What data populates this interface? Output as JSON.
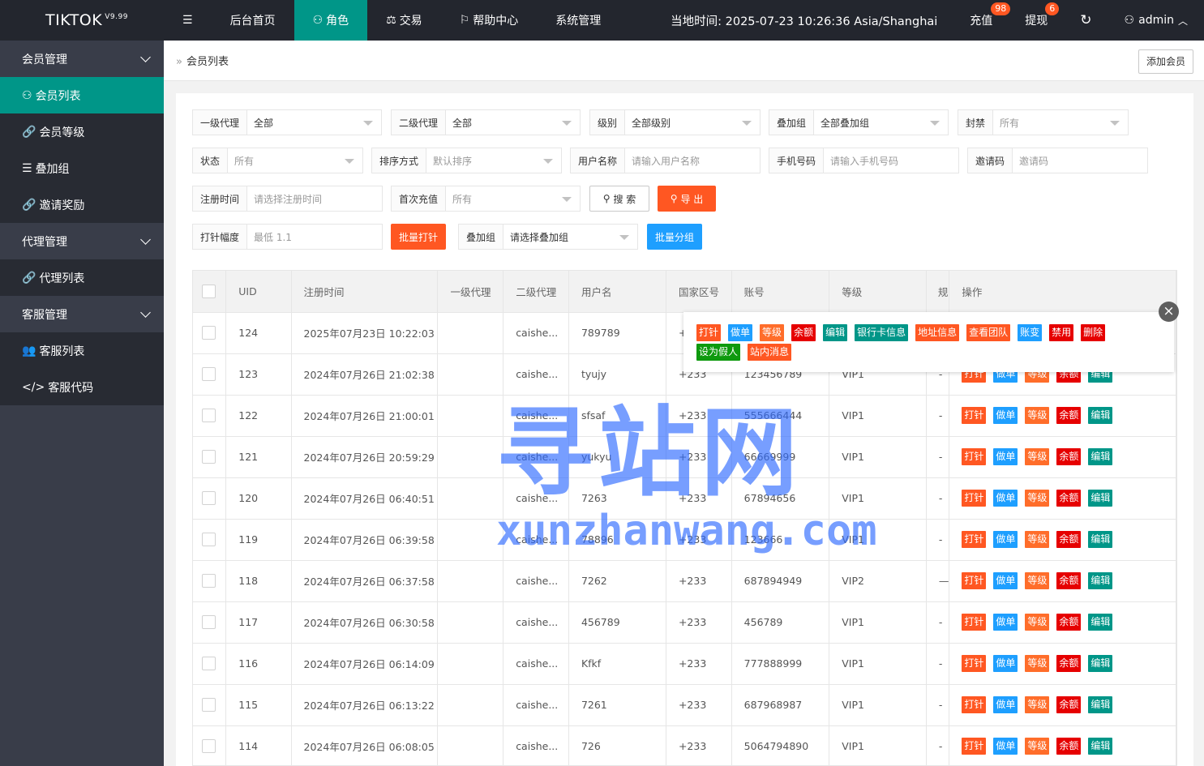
{
  "app": {
    "logo": "TIKTOK",
    "version": "V9.99"
  },
  "topnav": [
    {
      "label": "后台首页",
      "icon": ""
    },
    {
      "label": "角色",
      "icon": "user-icon"
    },
    {
      "label": "交易",
      "icon": "scale-icon"
    },
    {
      "label": "帮助中心",
      "icon": "flag-icon"
    },
    {
      "label": "系统管理",
      "icon": ""
    }
  ],
  "topright": {
    "time": "当地时间: 2025-07-23 10:26:36  Asia/Shanghai",
    "recharge": "充值",
    "recharge_badge": "98",
    "withdraw": "提现",
    "withdraw_badge": "6",
    "user": "admin"
  },
  "sidebar": {
    "g1": "会员管理",
    "i1": "会员列表",
    "i2": "会员等级",
    "i3": "叠加组",
    "i4": "邀请奖励",
    "g2": "代理管理",
    "i5": "代理列表",
    "g3": "客服管理",
    "i6": "客服列表",
    "i7": "客服代码"
  },
  "crumb": "会员列表",
  "add_member": "添加会员",
  "filters": {
    "agent1": {
      "label": "一级代理",
      "value": "全部"
    },
    "agent2": {
      "label": "二级代理",
      "value": "全部"
    },
    "level": {
      "label": "级别",
      "value": "全部级别"
    },
    "group": {
      "label": "叠加组",
      "value": "全部叠加组"
    },
    "ban": {
      "label": "封禁",
      "value": "所有"
    },
    "status": {
      "label": "状态",
      "value": "所有"
    },
    "sort": {
      "label": "排序方式",
      "value": "默认排序"
    },
    "username": {
      "label": "用户名称",
      "placeholder": "请输入用户名称"
    },
    "phone": {
      "label": "手机号码",
      "placeholder": "请输入手机号码"
    },
    "invite": {
      "label": "邀请码",
      "placeholder": "邀请码"
    },
    "regtime": {
      "label": "注册时间",
      "placeholder": "请选择注册时间"
    },
    "firstcharge": {
      "label": "首次充值",
      "value": "所有"
    },
    "search": "搜 索",
    "export": "导 出",
    "range": {
      "label": "打针幅度",
      "placeholder": "最低 1.1"
    },
    "batch_inject": "批量打针",
    "group2": {
      "label": "叠加组",
      "value": "请选择叠加组"
    },
    "batch_group": "批量分组"
  },
  "table": {
    "headers": [
      "UID",
      "注册时间",
      "一级代理",
      "二级代理",
      "用户名",
      "国家区号",
      "账号",
      "等级",
      "规",
      "操作"
    ],
    "rows": [
      {
        "uid": "124",
        "time": "2025年07月23日 10:22:03",
        "a1": "",
        "a2": "caishe...",
        "user": "789789",
        "cc": "+",
        "acc": "",
        "lvl": "",
        "x": ""
      },
      {
        "uid": "123",
        "time": "2024年07月26日 21:02:38",
        "a1": "",
        "a2": "caishe...",
        "user": "tyujy",
        "cc": "+233",
        "acc": "123456789",
        "lvl": "VIP1",
        "x": "-"
      },
      {
        "uid": "122",
        "time": "2024年07月26日 21:00:01",
        "a1": "",
        "a2": "caishe...",
        "user": "sfsaf",
        "cc": "+233",
        "acc": "555666444",
        "lvl": "VIP1",
        "x": "-"
      },
      {
        "uid": "121",
        "time": "2024年07月26日 20:59:29",
        "a1": "",
        "a2": "caishe...",
        "user": "yukyu",
        "cc": "+233",
        "acc": "66669999",
        "lvl": "VIP1",
        "x": "-"
      },
      {
        "uid": "120",
        "time": "2024年07月26日 06:40:51",
        "a1": "",
        "a2": "caishe...",
        "user": "7263",
        "cc": "+233",
        "acc": "67894656",
        "lvl": "VIP1",
        "x": "-"
      },
      {
        "uid": "119",
        "time": "2024年07月26日 06:39:58",
        "a1": "",
        "a2": "caishe...",
        "user": "78896",
        "cc": "+233",
        "acc": "123666",
        "lvl": "VIP1",
        "x": "-"
      },
      {
        "uid": "118",
        "time": "2024年07月26日 06:37:58",
        "a1": "",
        "a2": "caishe...",
        "user": "7262",
        "cc": "+233",
        "acc": "687894949",
        "lvl": "VIP2",
        "x": "—"
      },
      {
        "uid": "117",
        "time": "2024年07月26日 06:30:58",
        "a1": "",
        "a2": "caishe...",
        "user": "456789",
        "cc": "+233",
        "acc": "456789",
        "lvl": "VIP1",
        "x": "-"
      },
      {
        "uid": "116",
        "time": "2024年07月26日 06:14:09",
        "a1": "",
        "a2": "caishe...",
        "user": "Kfkf",
        "cc": "+233",
        "acc": "777888999",
        "lvl": "VIP1",
        "x": "-"
      },
      {
        "uid": "115",
        "time": "2024年07月26日 06:13:22",
        "a1": "",
        "a2": "caishe...",
        "user": "7261",
        "cc": "+233",
        "acc": "687968987",
        "lvl": "VIP1",
        "x": "-"
      },
      {
        "uid": "114",
        "time": "2024年07月26日 06:08:05",
        "a1": "",
        "a2": "caishe...",
        "user": "726",
        "cc": "+233",
        "acc": "5064794890",
        "lvl": "VIP1",
        "x": "-"
      }
    ],
    "ops": [
      {
        "label": "打针",
        "color": "c-orange"
      },
      {
        "label": "做单",
        "color": "c-blue"
      },
      {
        "label": "等级",
        "color": "c-org2"
      },
      {
        "label": "余额",
        "color": "c-darkred"
      },
      {
        "label": "编辑",
        "color": "c-teal"
      }
    ]
  },
  "popup": {
    "row1": [
      {
        "label": "打针",
        "color": "c-orange"
      },
      {
        "label": "做单",
        "color": "c-blue"
      },
      {
        "label": "等级",
        "color": "c-org2"
      },
      {
        "label": "余额",
        "color": "c-darkred"
      },
      {
        "label": "编辑",
        "color": "c-teal"
      },
      {
        "label": "银行卡信息",
        "color": "c-teal"
      },
      {
        "label": "地址信息",
        "color": "c-orange"
      },
      {
        "label": "查看团队",
        "color": "c-orange"
      },
      {
        "label": "账变",
        "color": "c-blue"
      },
      {
        "label": "禁用",
        "color": "c-darkred"
      },
      {
        "label": "删除",
        "color": "c-darkred"
      }
    ],
    "row2": [
      {
        "label": "设为假人",
        "color": "c-green"
      },
      {
        "label": "站内消息",
        "color": "c-orange"
      }
    ],
    "close": "×"
  },
  "watermark": {
    "cn": "寻站网",
    "en": "xunzhanwang.com"
  }
}
